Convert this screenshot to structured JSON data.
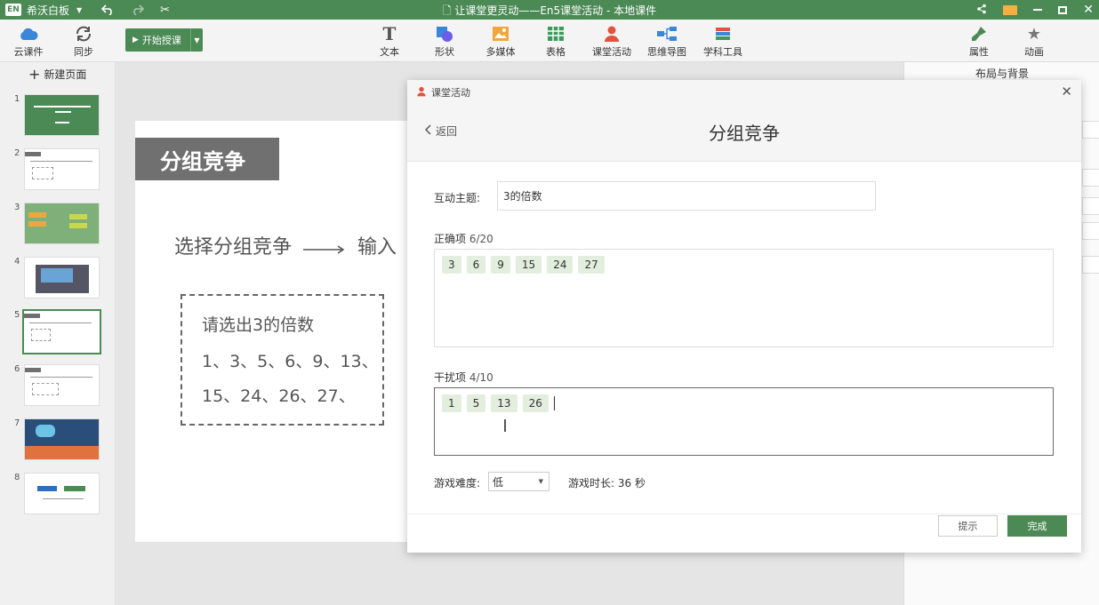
{
  "titlebar": {
    "app_logo": "EN",
    "app_name": "希沃白板",
    "window_title": "让课堂更灵动——En5课堂活动 - 本地课件"
  },
  "toolbar": {
    "cloud": "云课件",
    "sync": "同步",
    "start": "开始授课",
    "text": "文本",
    "shape": "形状",
    "media": "多媒体",
    "table": "表格",
    "activity": "课堂活动",
    "mindmap": "思维导图",
    "subject": "学科工具",
    "properties": "属性",
    "animation": "动画"
  },
  "sidebar": {
    "new_page": "新建页面",
    "thumbs": [
      "1",
      "2",
      "3",
      "4",
      "5",
      "6",
      "7",
      "8"
    ]
  },
  "slide": {
    "title": "分组竞争",
    "flow_text": "选择分组竞争",
    "flow_next": "输入",
    "question": "请选出3的倍数",
    "numbers_line1": "1、3、5、6、9、13、",
    "numbers_line2": "15、24、26、27、"
  },
  "right_panel": {
    "title": "布局与背景"
  },
  "dialog": {
    "caption": "课堂活动",
    "back": "返回",
    "title": "分组竞争",
    "topic_label": "互动主题:",
    "topic_value": "3的倍数",
    "correct_label": "正确项",
    "correct_count": "6/20",
    "correct_items": [
      "3",
      "6",
      "9",
      "15",
      "24",
      "27"
    ],
    "distract_label": "干扰项",
    "distract_count": "4/10",
    "distract_items": [
      "1",
      "5",
      "13",
      "26"
    ],
    "difficulty_label": "游戏难度:",
    "difficulty_value": "低",
    "duration_label": "游戏时长:",
    "duration_value": "36 秒",
    "hint_button": "提示",
    "done_button": "完成"
  },
  "colors": {
    "brand": "#4b8a55",
    "tag_bg": "#e3eedf"
  }
}
